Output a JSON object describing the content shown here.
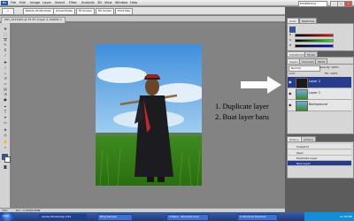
{
  "menubar": {
    "items": [
      "File",
      "Edit",
      "Image",
      "Layer",
      "Select",
      "Filter",
      "Analysis",
      "3D",
      "View",
      "Window",
      "Help"
    ],
    "workspace": "ESSENTIALS",
    "buttons": [
      "_",
      "□",
      "x"
    ]
  },
  "options": {
    "resize_windows": "Resize All Windows",
    "actual_pixels": "Actual Pixels",
    "fit_screen": "Fit Screen",
    "fill_screen": "Fill Screen",
    "print_size": "Print Size"
  },
  "document": {
    "tab": "DSC_0123.JPG @ 33.3% (Layer 2, RGB/8) ×"
  },
  "status": {
    "zoom": "33%",
    "doc": "Doc: 3.44M/6.89M"
  },
  "annotation": {
    "line1": "1. Duplicate layer",
    "line2": "2. Buat layer baru"
  },
  "panels": {
    "top_tabs": [
      "Color",
      "Swatches"
    ],
    "adjust_tabs": [
      "Adjustments",
      "Styles"
    ],
    "sliders": [
      "R",
      "G",
      "B"
    ],
    "layer_tabs": [
      "Layers",
      "Channels",
      "Paths"
    ],
    "blend_mode": "Normal",
    "opacity": "Opacity: 100%",
    "lock": "Lock:",
    "fill": "Fill: 100%",
    "layers": [
      "Layer 2",
      "Layer 1",
      "Background"
    ],
    "history_tabs": [
      "History",
      "Actions"
    ],
    "history_items": [
      "Snapshot",
      "Open",
      "Duplicate Layer",
      "New Layer"
    ]
  },
  "taskbar": {
    "start": "start",
    "tasks": [
      "Adobe Photoshop CS4",
      "Blog Sample",
      "4 Mere - Windows Live",
      "2 Windows Explorer"
    ],
    "tray_time": "11:09 PM"
  },
  "colors": {
    "selection": "#273c8c",
    "arrow": "#ffffff",
    "taskbar": "#1d3a7d"
  }
}
